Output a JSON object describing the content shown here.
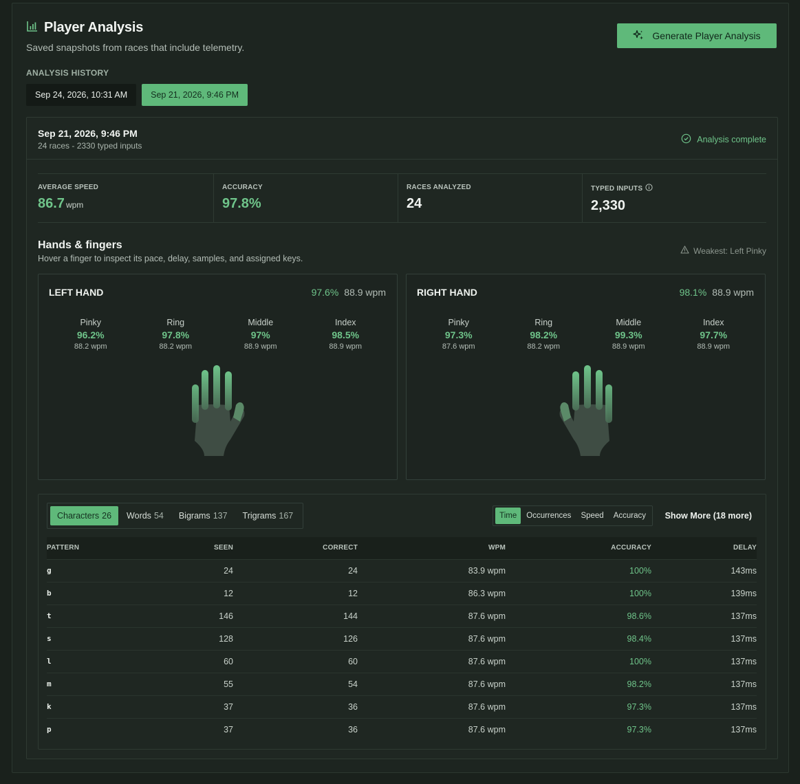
{
  "header": {
    "title": "Player Analysis",
    "subtitle": "Saved snapshots from races that include telemetry.",
    "generate_label": "Generate Player Analysis"
  },
  "history": {
    "label": "ANALYSIS HISTORY",
    "tabs": [
      {
        "label": "Sep 24, 2026, 10:31 AM",
        "active": false
      },
      {
        "label": "Sep 21, 2026, 9:46 PM",
        "active": true
      }
    ]
  },
  "snapshot": {
    "date": "Sep 21, 2026, 9:46 PM",
    "meta": "24 races - 2330 typed inputs",
    "status": "Analysis complete"
  },
  "stats": [
    {
      "label": "AVERAGE SPEED",
      "value": "86.7",
      "unit": "wpm"
    },
    {
      "label": "ACCURACY",
      "value": "97.8%",
      "unit": ""
    },
    {
      "label": "RACES ANALYZED",
      "value": "24",
      "unit": ""
    },
    {
      "label": "TYPED INPUTS",
      "value": "2,330",
      "unit": ""
    }
  ],
  "hands_section": {
    "title": "Hands & fingers",
    "subtitle": "Hover a finger to inspect its pace, delay, samples, and assigned keys.",
    "weakest": "Weakest: Left Pinky"
  },
  "left_hand": {
    "name": "LEFT HAND",
    "accuracy": "97.6%",
    "wpm": "88.9 wpm",
    "fingers": [
      {
        "name": "Pinky",
        "accuracy": "96.2%",
        "wpm": "88.2 wpm"
      },
      {
        "name": "Ring",
        "accuracy": "97.8%",
        "wpm": "88.2 wpm"
      },
      {
        "name": "Middle",
        "accuracy": "97%",
        "wpm": "88.9 wpm"
      },
      {
        "name": "Index",
        "accuracy": "98.5%",
        "wpm": "88.9 wpm"
      }
    ]
  },
  "right_hand": {
    "name": "RIGHT HAND",
    "accuracy": "98.1%",
    "wpm": "88.9 wpm",
    "fingers": [
      {
        "name": "Pinky",
        "accuracy": "97.3%",
        "wpm": "87.6 wpm"
      },
      {
        "name": "Ring",
        "accuracy": "98.2%",
        "wpm": "88.2 wpm"
      },
      {
        "name": "Middle",
        "accuracy": "99.3%",
        "wpm": "88.9 wpm"
      },
      {
        "name": "Index",
        "accuracy": "97.7%",
        "wpm": "88.9 wpm"
      }
    ]
  },
  "pattern_tabs": [
    {
      "label": "Characters",
      "count": "26"
    },
    {
      "label": "Words",
      "count": "54"
    },
    {
      "label": "Bigrams",
      "count": "137"
    },
    {
      "label": "Trigrams",
      "count": "167"
    }
  ],
  "sort_options": [
    "Time",
    "Occurrences",
    "Speed",
    "Accuracy"
  ],
  "show_more": "Show More (18 more)",
  "table": {
    "headers": [
      "PATTERN",
      "SEEN",
      "CORRECT",
      "WPM",
      "ACCURACY",
      "DELAY"
    ],
    "rows": [
      [
        "g",
        "24",
        "24",
        "83.9 wpm",
        "100%",
        "143ms"
      ],
      [
        "b",
        "12",
        "12",
        "86.3 wpm",
        "100%",
        "139ms"
      ],
      [
        "t",
        "146",
        "144",
        "87.6 wpm",
        "98.6%",
        "137ms"
      ],
      [
        "s",
        "128",
        "126",
        "87.6 wpm",
        "98.4%",
        "137ms"
      ],
      [
        "l",
        "60",
        "60",
        "87.6 wpm",
        "100%",
        "137ms"
      ],
      [
        "m",
        "55",
        "54",
        "87.6 wpm",
        "98.2%",
        "137ms"
      ],
      [
        "k",
        "37",
        "36",
        "87.6 wpm",
        "97.3%",
        "137ms"
      ],
      [
        "p",
        "37",
        "36",
        "87.6 wpm",
        "97.3%",
        "137ms"
      ]
    ]
  },
  "colors": {
    "accent": "#5fb97a",
    "background": "#1a211c"
  }
}
